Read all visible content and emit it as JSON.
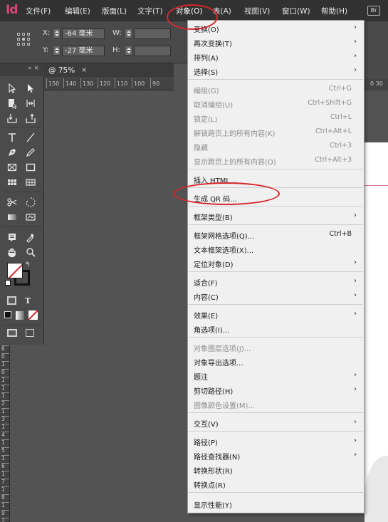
{
  "app": {
    "logo": "Id"
  },
  "menubar": {
    "items": [
      "文件(F)",
      "编辑(E)",
      "版面(L)",
      "文字(T)",
      "对象(O)",
      "表(A)",
      "视图(V)",
      "窗口(W)",
      "帮助(H)"
    ],
    "br_label": "Br"
  },
  "control_bar": {
    "x_label": "X:",
    "x_value": "-64 毫米",
    "y_label": "Y:",
    "y_value": "-27 毫米",
    "w_label": "W:",
    "h_label": "H:"
  },
  "document": {
    "tab_label": "@ 75%",
    "tab_close": "×",
    "ruler_ticks": [
      "150",
      "140",
      "130",
      "120",
      "110",
      "100",
      "90"
    ],
    "right_ruler_tick": "0 30",
    "vruler_ticks": [
      "6",
      "0",
      "1",
      "0",
      "1",
      "1",
      "1",
      "2",
      "1",
      "3",
      "1",
      "4",
      "1",
      "5",
      "1",
      "6",
      "1",
      "7",
      "1",
      "8",
      "1",
      "9",
      "2"
    ]
  },
  "menu": {
    "items": [
      {
        "label": "变换(O)",
        "shortcut": "",
        "arrow": "›",
        "disabled": false
      },
      {
        "label": "再次变换(T)",
        "shortcut": "",
        "arrow": "›",
        "disabled": false
      },
      {
        "label": "排列(A)",
        "shortcut": "",
        "arrow": "›",
        "disabled": false
      },
      {
        "label": "选择(S)",
        "shortcut": "",
        "arrow": "›",
        "disabled": false
      },
      {
        "label": "编组(G)",
        "shortcut": "Ctrl+G",
        "arrow": "",
        "disabled": true
      },
      {
        "label": "取消编组(U)",
        "shortcut": "Ctrl+Shift+G",
        "arrow": "",
        "disabled": true
      },
      {
        "label": "锁定(L)",
        "shortcut": "Ctrl+L",
        "arrow": "",
        "disabled": true
      },
      {
        "label": "解锁跨页上的所有内容(K)",
        "shortcut": "Ctrl+Alt+L",
        "arrow": "",
        "disabled": true
      },
      {
        "label": "隐藏",
        "shortcut": "Ctrl+3",
        "arrow": "",
        "disabled": true
      },
      {
        "label": "显示跨页上的所有内容(O)",
        "shortcut": "Ctrl+Alt+3",
        "arrow": "",
        "disabled": true
      },
      {
        "label": "插入 HTML...",
        "shortcut": "",
        "arrow": "",
        "disabled": false
      },
      {
        "label": "生成 QR 码...",
        "shortcut": "",
        "arrow": "",
        "disabled": false
      },
      {
        "label": "框架类型(B)",
        "shortcut": "",
        "arrow": "›",
        "disabled": false
      },
      {
        "label": "框架网格选项(Q)...",
        "shortcut": "Ctrl+B",
        "arrow": "",
        "disabled": false
      },
      {
        "label": "文本框架选项(X)...",
        "shortcut": "",
        "arrow": "",
        "disabled": false
      },
      {
        "label": "定位对象(D)",
        "shortcut": "",
        "arrow": "›",
        "disabled": false
      },
      {
        "label": "适合(F)",
        "shortcut": "",
        "arrow": "›",
        "disabled": false
      },
      {
        "label": "内容(C)",
        "shortcut": "",
        "arrow": "›",
        "disabled": false
      },
      {
        "label": "效果(E)",
        "shortcut": "",
        "arrow": "›",
        "disabled": false
      },
      {
        "label": "角选项(I)...",
        "shortcut": "",
        "arrow": "",
        "disabled": false
      },
      {
        "label": "对象图层选项(J)...",
        "shortcut": "",
        "arrow": "",
        "disabled": true
      },
      {
        "label": "对象导出选项...",
        "shortcut": "",
        "arrow": "",
        "disabled": false
      },
      {
        "label": "题注",
        "shortcut": "",
        "arrow": "›",
        "disabled": false
      },
      {
        "label": "剪切路径(H)",
        "shortcut": "",
        "arrow": "›",
        "disabled": false
      },
      {
        "label": "图像颜色设置(M)...",
        "shortcut": "",
        "arrow": "",
        "disabled": true
      },
      {
        "label": "交互(V)",
        "shortcut": "",
        "arrow": "›",
        "disabled": false
      },
      {
        "label": "路径(P)",
        "shortcut": "",
        "arrow": "›",
        "disabled": false
      },
      {
        "label": "路径查找器(N)",
        "shortcut": "",
        "arrow": "›",
        "disabled": false
      },
      {
        "label": "转换形状(R)",
        "shortcut": "",
        "arrow": "",
        "disabled": false
      },
      {
        "label": "转换点(R)",
        "shortcut": "",
        "arrow": "",
        "disabled": false
      },
      {
        "label": "显示性能(Y)",
        "shortcut": "",
        "arrow": "",
        "disabled": false
      }
    ]
  },
  "tools": [
    "selection-tool",
    "direct-selection-tool",
    "page-tool",
    "gap-tool",
    "content-collector-tool",
    "content-placer-tool",
    "type-tool",
    "line-tool",
    "pen-tool",
    "pencil-tool",
    "rectangle-frame-tool",
    "rectangle-tool",
    "table-tool",
    "grid-tool",
    "scissors-tool",
    "transform-tool",
    "gradient-swatch-tool",
    "gradient-feather-tool",
    "note-tool",
    "eyedropper-tool",
    "hand-tool",
    "zoom-tool"
  ],
  "colors": {
    "accent": "#d6262c",
    "menu_bg": "#f0f0f0",
    "chrome_bg": "#323232",
    "panel_bg": "#4b4b4b"
  }
}
